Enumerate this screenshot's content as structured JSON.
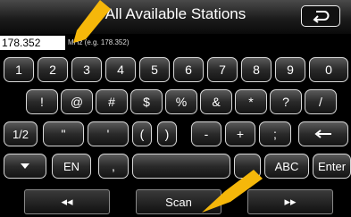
{
  "header": {
    "title": "All Available Stations"
  },
  "input": {
    "value": "178.352",
    "hint": "MHz (e.g. 178.352)"
  },
  "keyboard": {
    "row1": [
      "1",
      "2",
      "3",
      "4",
      "5",
      "6",
      "7",
      "8",
      "9",
      "0"
    ],
    "row2": [
      "!",
      "@",
      "#",
      "$",
      "%",
      "&",
      "*",
      "?",
      "/"
    ],
    "row3": [
      "1/2",
      "\"",
      "'",
      "(",
      ")",
      "-",
      "+",
      ";"
    ],
    "row4": {
      "lang": "EN",
      "comma": ",",
      "mode": "ABC",
      "enter": "Enter"
    }
  },
  "bottom": {
    "prev": "◂◂",
    "scan": "Scan",
    "next": "▸▸"
  },
  "colors": {
    "arrow": "#f5b70a",
    "key_border": "#d8d8d8"
  }
}
